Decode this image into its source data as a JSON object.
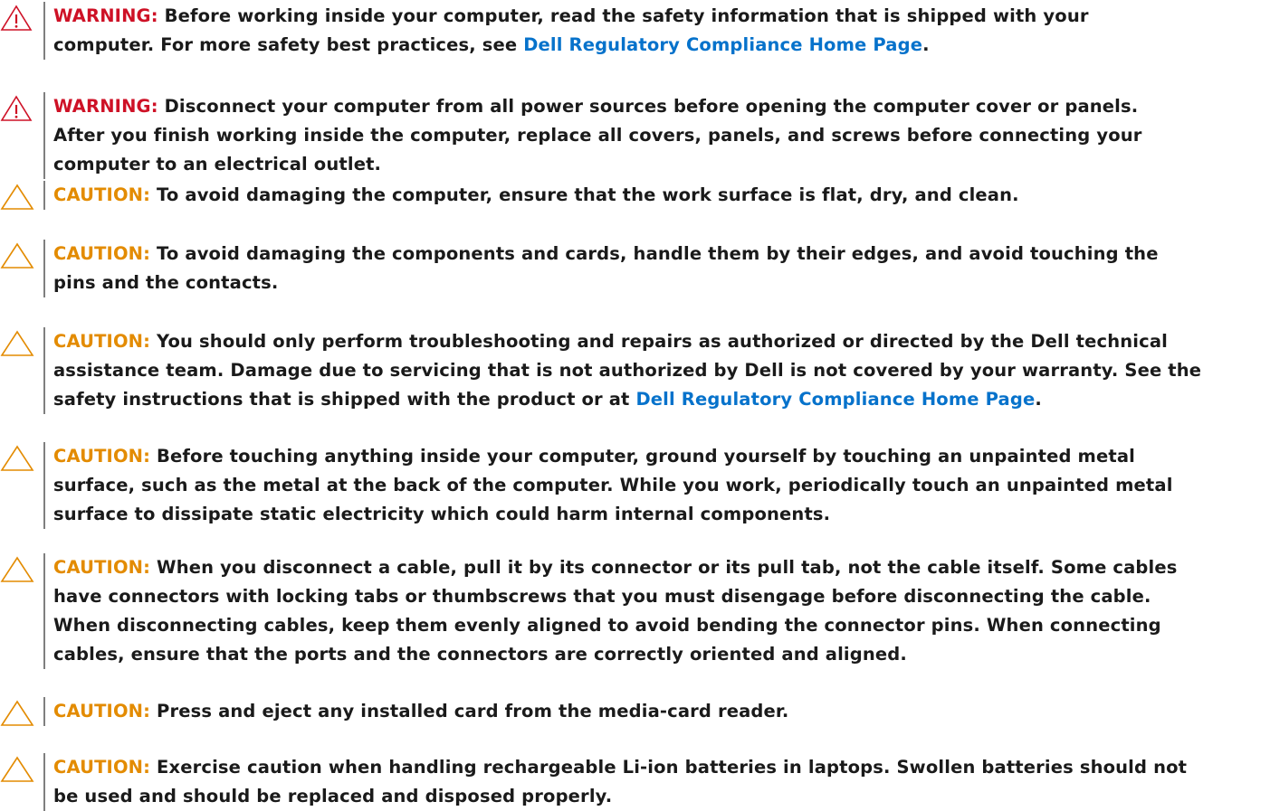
{
  "colors": {
    "warning": "#ce1126",
    "caution": "#e38b00",
    "link": "#0672cb",
    "text": "#1a1a1a"
  },
  "notices": [
    {
      "type": "warning",
      "icon": "warning-triangle-exclamation-icon",
      "label": "WARNING:",
      "lines": [
        [
          {
            "t": " Before working inside your computer, read the safety information that is shipped with your"
          }
        ],
        [
          {
            "t": "computer. For more safety best practices, see "
          },
          {
            "t": "Dell Regulatory Compliance Home Page",
            "link": true
          },
          {
            "t": "."
          }
        ]
      ]
    },
    {
      "type": "warning",
      "icon": "warning-triangle-exclamation-icon",
      "label": "WARNING:",
      "lines": [
        [
          {
            "t": " Disconnect your computer from all power sources before opening the computer cover or panels."
          }
        ],
        [
          {
            "t": "After you finish working inside the computer, replace all covers, panels, and screws before connecting your"
          }
        ],
        [
          {
            "t": "computer to an electrical outlet."
          }
        ]
      ]
    },
    {
      "type": "caution",
      "icon": "caution-triangle-icon",
      "label": "CAUTION:",
      "lines": [
        [
          {
            "t": " To avoid damaging the computer, ensure that the work surface is flat, dry, and clean."
          }
        ]
      ]
    },
    {
      "type": "caution",
      "icon": "caution-triangle-icon",
      "label": "CAUTION:",
      "lines": [
        [
          {
            "t": " To avoid damaging the components and cards, handle them by their edges, and avoid touching the"
          }
        ],
        [
          {
            "t": "pins and the contacts."
          }
        ]
      ]
    },
    {
      "type": "caution",
      "icon": "caution-triangle-icon",
      "label": "CAUTION:",
      "lines": [
        [
          {
            "t": " You should only perform troubleshooting and repairs as authorized or directed by the Dell technical"
          }
        ],
        [
          {
            "t": "assistance team. Damage due to servicing that is not authorized by Dell is not covered by your warranty. See the"
          }
        ],
        [
          {
            "t": "safety instructions that is shipped with the product or at "
          },
          {
            "t": "Dell Regulatory Compliance Home Page",
            "link": true
          },
          {
            "t": "."
          }
        ]
      ]
    },
    {
      "type": "caution",
      "icon": "caution-triangle-icon",
      "label": "CAUTION:",
      "lines": [
        [
          {
            "t": " Before touching anything inside your computer, ground yourself by touching an unpainted metal"
          }
        ],
        [
          {
            "t": "surface, such as the metal at the back of the computer. While you work, periodically touch an unpainted metal"
          }
        ],
        [
          {
            "t": "surface to dissipate static electricity which could harm internal components."
          }
        ]
      ]
    },
    {
      "type": "caution",
      "icon": "caution-triangle-icon",
      "label": "CAUTION:",
      "lines": [
        [
          {
            "t": " When you disconnect a cable, pull it by its connector or its pull tab, not the cable itself. Some cables"
          }
        ],
        [
          {
            "t": "have connectors with locking tabs or thumbscrews that you must disengage before disconnecting the cable."
          }
        ],
        [
          {
            "t": "When disconnecting cables, keep them evenly aligned to avoid bending the connector pins. When connecting"
          }
        ],
        [
          {
            "t": "cables, ensure that the ports and the connectors are correctly oriented and aligned."
          }
        ]
      ]
    },
    {
      "type": "caution",
      "icon": "caution-triangle-icon",
      "label": "CAUTION:",
      "lines": [
        [
          {
            "t": " Press and eject any installed card from the media-card reader."
          }
        ]
      ]
    },
    {
      "type": "caution",
      "icon": "caution-triangle-icon",
      "label": "CAUTION:",
      "lines": [
        [
          {
            "t": " Exercise caution when handling rechargeable Li-ion batteries in laptops. Swollen batteries should not"
          }
        ],
        [
          {
            "t": "be used and should be replaced and disposed properly."
          }
        ]
      ]
    }
  ]
}
